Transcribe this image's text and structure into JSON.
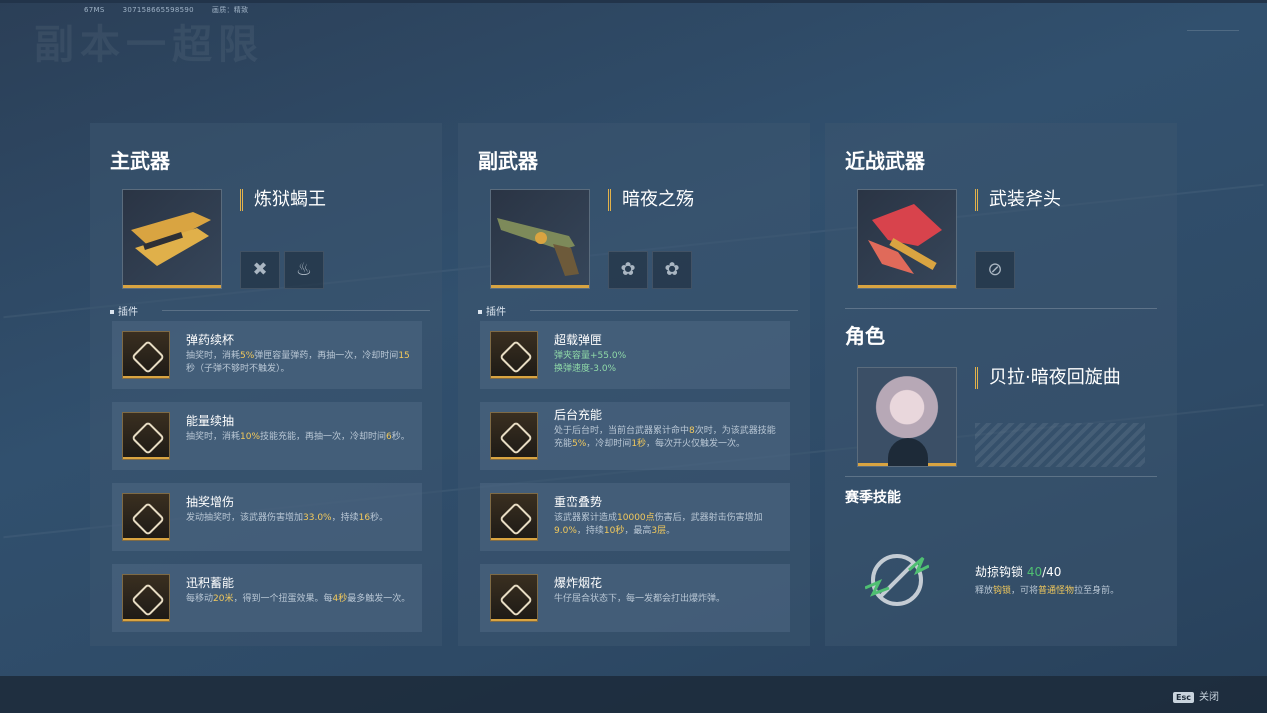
{
  "top_info": {
    "ms": "67MS",
    "id": "307158665598590",
    "quality_label": "画质：精致"
  },
  "bg_title": "副本一超限",
  "primary": {
    "title": "主武器",
    "weapon_name": "炼狱蝎王",
    "section_label": "插件",
    "plugins": [
      {
        "name": "弹药续杯",
        "desc_parts": [
          "抽奖时，消耗",
          "5%",
          "弹匣容量弹药，再抽一次，冷却时间",
          "15",
          "秒（子弹不够时不触发）。"
        ]
      },
      {
        "name": "能量续抽",
        "desc_parts": [
          "抽奖时，消耗",
          "10%",
          "技能充能，再抽一次，冷却时间",
          "6",
          "秒。"
        ]
      },
      {
        "name": "抽奖增伤",
        "desc_parts": [
          "发动抽奖时，该武器伤害增加",
          "33.0%",
          "，持续",
          "16",
          "秒。"
        ]
      },
      {
        "name": "迅积蓄能",
        "desc_parts": [
          "每移动",
          "20米",
          "，得到一个扭蛋效果。每",
          "4秒",
          "最多触发一次。"
        ]
      }
    ]
  },
  "secondary": {
    "title": "副武器",
    "weapon_name": "暗夜之殇",
    "section_label": "插件",
    "plugins": [
      {
        "name": "超载弹匣",
        "desc_lines": [
          "弹夹容量+55.0%",
          "换弹速度-3.0%"
        ]
      },
      {
        "name": "后台充能",
        "desc_parts": [
          "处于后台时，当前台武器累计命中",
          "8",
          "次时，为该武器技能充能",
          "5%",
          "，冷却时间",
          "1秒",
          "，每次开火仅触发一次。"
        ]
      },
      {
        "name": "重峦叠势",
        "desc_parts": [
          "该武器累计造成",
          "10000点",
          "伤害后，武器射击伤害增加",
          "9.0%",
          "，持续",
          "10秒",
          "，最高",
          "3层",
          "。"
        ]
      },
      {
        "name": "爆炸烟花",
        "desc_parts": [
          "牛仔居合状态下，每一发都会打出爆炸弹。"
        ]
      }
    ]
  },
  "melee": {
    "title": "近战武器",
    "weapon_name": "武装斧头",
    "role_title": "角色",
    "character_name": "贝拉·暗夜回旋曲",
    "season_title": "赛季技能",
    "skill_name": "劫掠钩锁",
    "skill_current": "40",
    "skill_max": "/40",
    "skill_desc_parts": [
      "释放",
      "钩锁",
      "，可将",
      "普通怪物",
      "拉至身前。"
    ]
  },
  "footer": {
    "esc_key": "Esc",
    "close_label": "关闭"
  },
  "colors": {
    "accent": "#e3b24a",
    "highlight": "#f2c95c",
    "green": "#4fbf72",
    "panel": "#3c5570"
  }
}
